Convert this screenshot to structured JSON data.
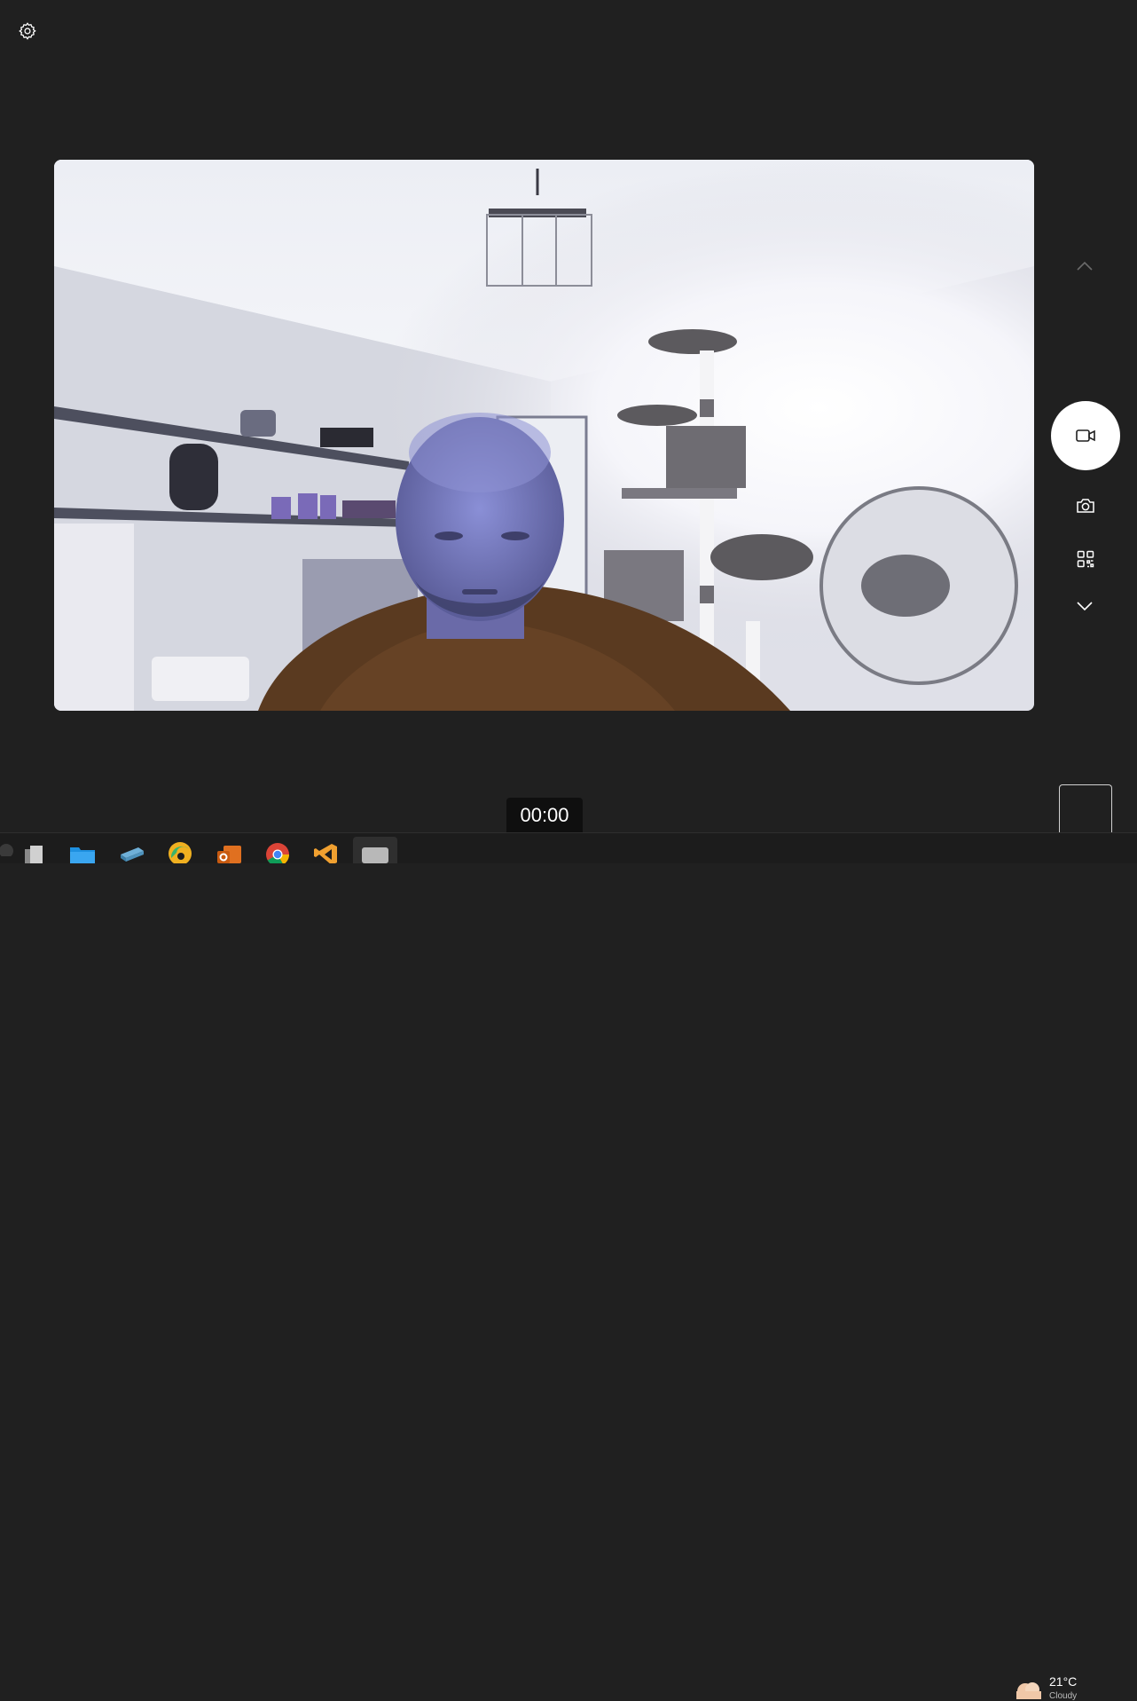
{
  "camera": {
    "timer": "00:00"
  },
  "controls": {
    "settings_icon": "gear-icon",
    "scroll_up_icon": "chevron-up-icon",
    "record_icon": "video-camera-icon",
    "photo_icon": "camera-icon",
    "qr_icon": "qr-code-icon",
    "scroll_down_icon": "chevron-down-icon"
  },
  "taskbar": {
    "apps": [
      {
        "icon": "task-view-icon"
      },
      {
        "icon": "file-explorer-icon"
      },
      {
        "icon": "scanner-icon"
      },
      {
        "icon": "edge-canary-icon"
      },
      {
        "icon": "outlook-icon"
      },
      {
        "icon": "chrome-icon"
      },
      {
        "icon": "visual-studio-icon"
      },
      {
        "icon": "camera-app-icon"
      }
    ],
    "weather": {
      "temp": "21°C",
      "condition": "Cloudy"
    }
  },
  "colors": {
    "background": "#202020",
    "taskbar": "#1c1c1c",
    "record_button": "#ffffff"
  }
}
